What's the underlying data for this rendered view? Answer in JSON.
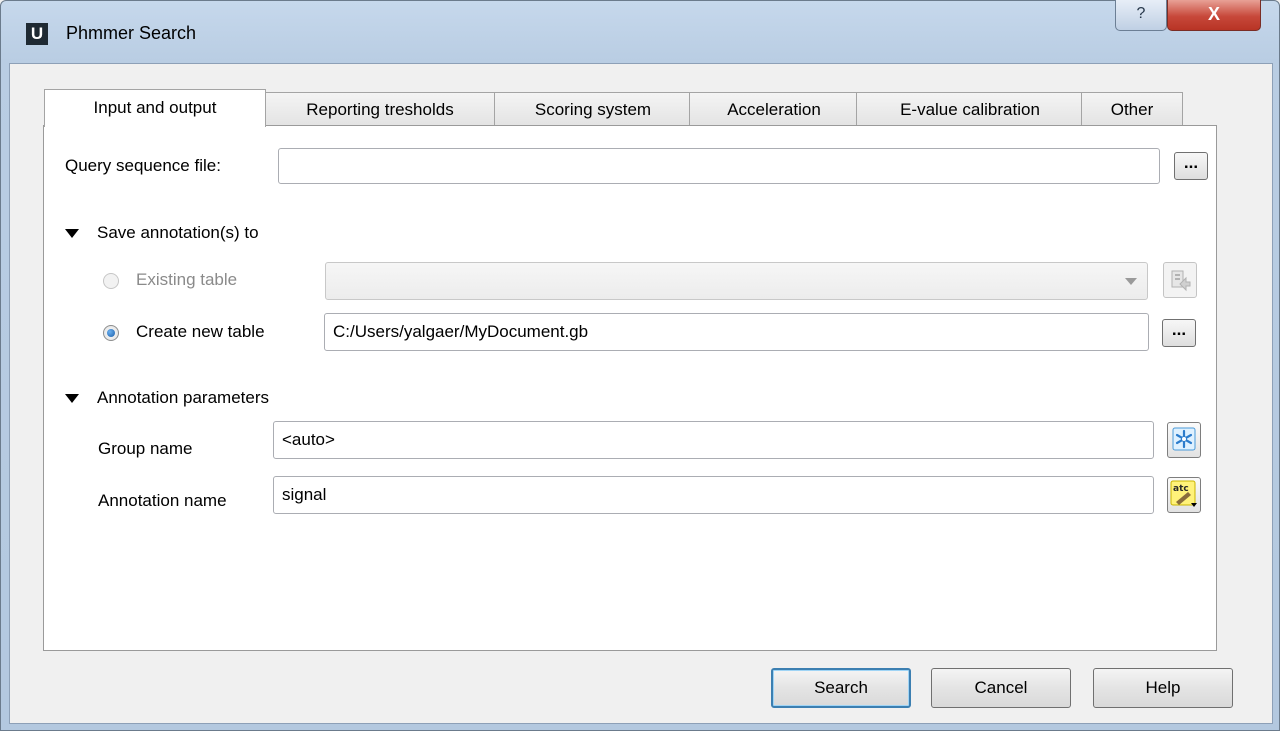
{
  "window": {
    "title": "Phmmer Search",
    "logo_letter": "U",
    "help_glyph": "?",
    "close_glyph": "X"
  },
  "tabs": [
    {
      "label": "Input and output",
      "active": true
    },
    {
      "label": "Reporting tresholds",
      "active": false
    },
    {
      "label": "Scoring system",
      "active": false
    },
    {
      "label": "Acceleration",
      "active": false
    },
    {
      "label": "E-value calibration",
      "active": false
    },
    {
      "label": "Other",
      "active": false
    }
  ],
  "query": {
    "label": "Query sequence file:",
    "value": "",
    "browse_label": "..."
  },
  "save_section": {
    "header": "Save annotation(s) to",
    "existing_table": {
      "label": "Existing table",
      "checked": false,
      "enabled": false,
      "value": ""
    },
    "new_table": {
      "label": "Create new table",
      "checked": true,
      "value": "C:/Users/yalgaer/MyDocument.gb",
      "browse_label": "..."
    }
  },
  "annotation_section": {
    "header": "Annotation parameters",
    "group_name": {
      "label": "Group name",
      "value": "<auto>"
    },
    "annotation_name": {
      "label": "Annotation name",
      "value": "signal"
    }
  },
  "buttons": {
    "search": "Search",
    "cancel": "Cancel",
    "help": "Help"
  },
  "colors": {
    "titlebar": "#b9cde3",
    "close_button": "#c7483a",
    "default_button_border": "#3c7fb1"
  }
}
